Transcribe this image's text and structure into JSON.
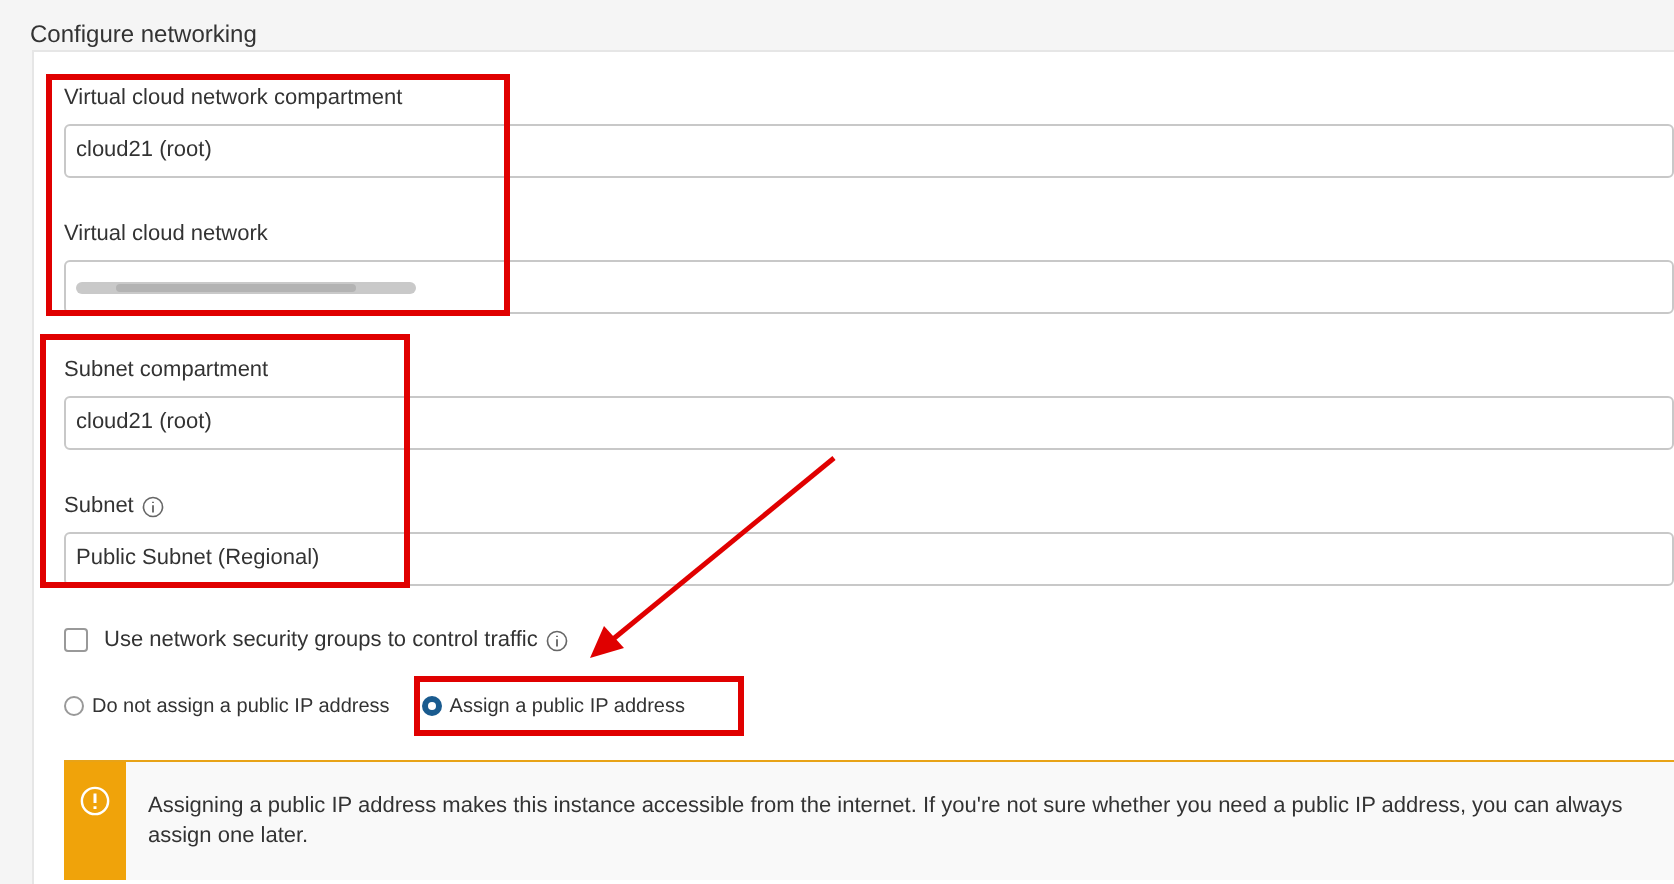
{
  "section": {
    "title": "Configure networking"
  },
  "fields": [
    {
      "label": "Virtual cloud network compartment",
      "value": "cloud21 (root)",
      "info": false,
      "blurred": false
    },
    {
      "label": "Virtual cloud network",
      "info": false,
      "blurred": true
    },
    {
      "label": "Subnet compartment",
      "value": "cloud21 (root)",
      "info": false,
      "blurred": false
    },
    {
      "label": "Subnet",
      "value": "Public Subnet (Regional)",
      "info": true,
      "blurred": false
    }
  ],
  "checkbox": {
    "label": "Use network security groups to control traffic",
    "checked": false,
    "info": true
  },
  "radios": [
    {
      "label": "Do not assign a public IP address",
      "selected": false
    },
    {
      "label": "Assign a public IP address",
      "selected": true
    }
  ],
  "warning": {
    "text": "Assigning a public IP address makes this instance accessible from the internet. If you're not sure whether you need a public IP address, you can always assign one later."
  }
}
